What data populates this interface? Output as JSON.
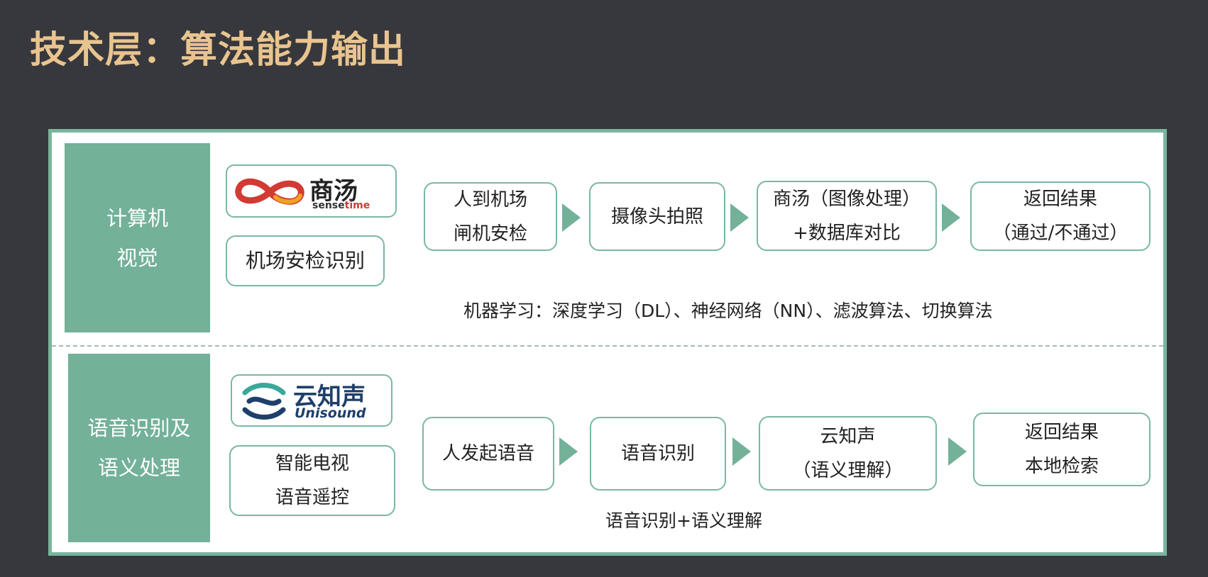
{
  "title": "技术层：算法能力输出",
  "colors": {
    "accent": "#73b199",
    "title": "#e9c48f",
    "background": "#37383d",
    "sensetime_red": "#d23a34",
    "unisound_navy": "#1e3f6a"
  },
  "rows": [
    {
      "category": [
        "计算机",
        "视觉"
      ],
      "logo": {
        "name": "sensetime-logo",
        "cn": "商汤",
        "en_a": "sense",
        "en_b": "time"
      },
      "use_case": [
        "机场安检识别"
      ],
      "steps": [
        [
          "人到机场",
          "闸机安检"
        ],
        [
          "摄像头拍照"
        ],
        [
          "商汤（图像处理）",
          "+数据库对比"
        ],
        [
          "返回结果",
          "（通过/不通过）"
        ]
      ],
      "caption": "机器学习：深度学习（DL）、神经网络（NN）、滤波算法、切换算法"
    },
    {
      "category": [
        "语音识别及",
        "语义处理"
      ],
      "logo": {
        "name": "unisound-logo",
        "cn": "云知声",
        "en": "Unisound"
      },
      "use_case": [
        "智能电视",
        "语音遥控"
      ],
      "steps": [
        [
          "人发起语音"
        ],
        [
          "语音识别"
        ],
        [
          "云知声",
          "（语义理解）"
        ],
        [
          "返回结果",
          "本地检索"
        ]
      ],
      "caption": "语音识别+语义理解"
    }
  ]
}
